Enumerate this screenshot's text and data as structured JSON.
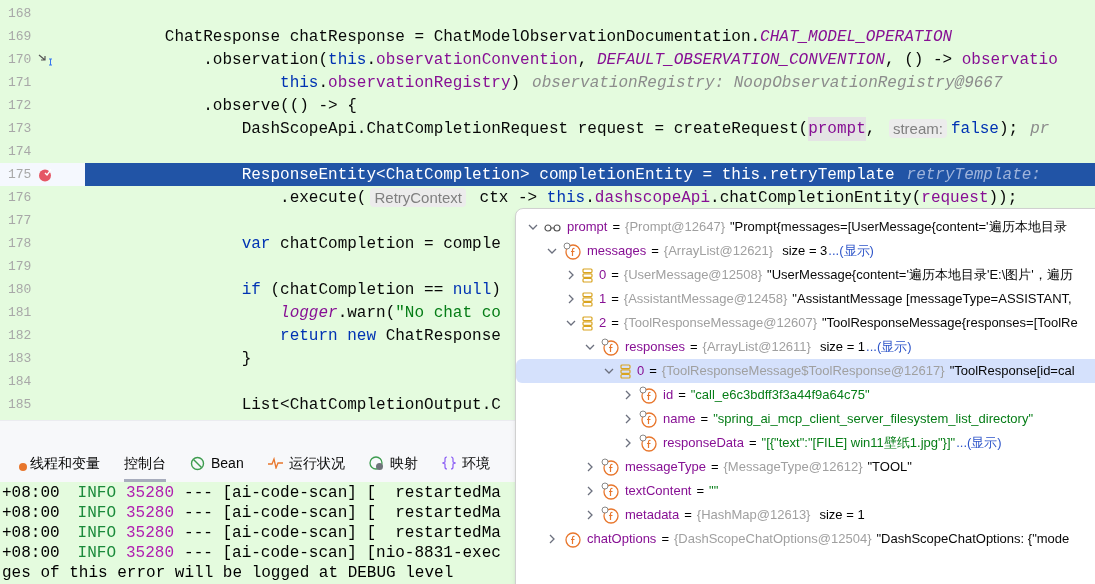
{
  "editor": {
    "lines": [
      {
        "number": "168",
        "kind": "code",
        "selected": false
      },
      {
        "number": "169",
        "kind": "code",
        "selected": false,
        "tokens": [
          {
            "kind": "plain",
            "text": "        ChatResponse chatResponse = ChatModelObservationDocumentation."
          },
          {
            "kind": "const",
            "text": "CHAT_MODEL_OPERATION"
          }
        ]
      },
      {
        "number": "170",
        "kind": "step",
        "selected": false,
        "tokens": [
          {
            "kind": "plain",
            "text": "            .observation("
          },
          {
            "kind": "kw",
            "text": "this"
          },
          {
            "kind": "plain",
            "text": "."
          },
          {
            "kind": "field",
            "text": "observationConvention"
          },
          {
            "kind": "plain",
            "text": ", "
          },
          {
            "kind": "const",
            "text": "DEFAULT_OBSERVATION_CONVENTION"
          },
          {
            "kind": "plain",
            "text": ", () -> "
          },
          {
            "kind": "field",
            "text": "observatio"
          }
        ]
      },
      {
        "number": "171",
        "kind": "code",
        "selected": false,
        "tokens": [
          {
            "kind": "kw",
            "text": "                    this"
          },
          {
            "kind": "plain",
            "text": "."
          },
          {
            "kind": "field",
            "text": "observationRegistry"
          },
          {
            "kind": "plain",
            "text": ")"
          },
          {
            "kind": "hint",
            "text": "observationRegistry: NoopObservationRegistry@9667"
          }
        ]
      },
      {
        "number": "172",
        "kind": "code",
        "selected": false,
        "tokens": [
          {
            "kind": "plain",
            "text": "            .observe(() -> {"
          }
        ]
      },
      {
        "number": "173",
        "kind": "code",
        "selected": false,
        "tokens": [
          {
            "kind": "plain",
            "text": "                DashScopeApi.ChatCompletionRequest request = createRequest("
          },
          {
            "kind": "usage",
            "text": "prompt"
          },
          {
            "kind": "plain",
            "text": ", "
          },
          {
            "kind": "inlay",
            "text": "stream:"
          },
          {
            "kind": "kw",
            "text": "false"
          },
          {
            "kind": "plain",
            "text": ");"
          },
          {
            "kind": "hint",
            "text": "pr"
          }
        ]
      },
      {
        "number": "174",
        "kind": "code",
        "selected": false
      },
      {
        "number": "175",
        "kind": "breakpoint",
        "selected": true,
        "tokens": [
          {
            "kind": "plain",
            "text": "                ResponseEntity<ChatCompletion> completionEntity = this.retryTemplate"
          },
          {
            "kind": "hint",
            "text": "retryTemplate:"
          }
        ]
      },
      {
        "number": "176",
        "kind": "code",
        "selected": false,
        "tokens": [
          {
            "kind": "plain",
            "text": "                    .execute("
          },
          {
            "kind": "inlay",
            "text": "RetryContext"
          },
          {
            "kind": "plain",
            "text": " ctx -> "
          },
          {
            "kind": "kw",
            "text": "this"
          },
          {
            "kind": "plain",
            "text": "."
          },
          {
            "kind": "field",
            "text": "dashscopeApi"
          },
          {
            "kind": "plain",
            "text": ".chatCompletionEntity("
          },
          {
            "kind": "field",
            "text": "request"
          },
          {
            "kind": "plain",
            "text": "));"
          }
        ]
      },
      {
        "number": "177",
        "kind": "code",
        "selected": false
      },
      {
        "number": "178",
        "kind": "code",
        "selected": false,
        "tokens": [
          {
            "kind": "kw",
            "text": "                var"
          },
          {
            "kind": "plain",
            "text": " chatCompletion = comple"
          }
        ]
      },
      {
        "number": "179",
        "kind": "code",
        "selected": false
      },
      {
        "number": "180",
        "kind": "code",
        "selected": false,
        "tokens": [
          {
            "kind": "kw",
            "text": "                if"
          },
          {
            "kind": "plain",
            "text": " (chatCompletion == "
          },
          {
            "kind": "kw",
            "text": "null"
          },
          {
            "kind": "plain",
            "text": ")"
          }
        ]
      },
      {
        "number": "181",
        "kind": "code",
        "selected": false,
        "tokens": [
          {
            "kind": "const",
            "text": "                    logger"
          },
          {
            "kind": "plain",
            "text": ".warn("
          },
          {
            "kind": "str",
            "text": "\"No chat co"
          }
        ]
      },
      {
        "number": "182",
        "kind": "code",
        "selected": false,
        "tokens": [
          {
            "kind": "kw",
            "text": "                    return new"
          },
          {
            "kind": "plain",
            "text": " ChatResponse"
          }
        ]
      },
      {
        "number": "183",
        "kind": "code",
        "selected": false,
        "tokens": [
          {
            "kind": "plain",
            "text": "                }"
          }
        ]
      },
      {
        "number": "184",
        "kind": "code",
        "selected": false
      },
      {
        "number": "185",
        "kind": "code",
        "selected": false,
        "tokens": [
          {
            "kind": "plain",
            "text": "                List<ChatCompletionOutput.C"
          }
        ]
      }
    ]
  },
  "bottom_panel": {
    "tabs": [
      {
        "label": "线程和变量",
        "kind": "threads",
        "selected": false
      },
      {
        "label": "控制台",
        "kind": "plain",
        "selected": true
      },
      {
        "label": "Bean",
        "kind": "bean",
        "selected": false
      },
      {
        "label": "运行状况",
        "kind": "health",
        "selected": false
      },
      {
        "label": "映射",
        "kind": "mappings",
        "selected": false
      },
      {
        "label": "环境",
        "kind": "environment",
        "selected": false
      }
    ],
    "console": [
      {
        "time": "+08:00",
        "level": "INFO",
        "pid": "35280",
        "text": "--- [ai-code-scan] [  restartedMa"
      },
      {
        "time": "+08:00",
        "level": "INFO",
        "pid": "35280",
        "text": "--- [ai-code-scan] [  restartedMa"
      },
      {
        "time": "+08:00",
        "level": "INFO",
        "pid": "35280",
        "text": "--- [ai-code-scan] [  restartedMa"
      },
      {
        "time": "+08:00",
        "level": "INFO",
        "pid": "35280",
        "text": "--- [ai-code-scan] [nio-8831-exec"
      },
      {
        "text": "ges of this error will be logged at DEBUG level"
      }
    ]
  },
  "debug_popup": {
    "tree": [
      {
        "kind": "watch",
        "name": "prompt",
        "op": "=",
        "type": "{Prompt@12647}",
        "value": "\"Prompt{messages=[UserMessage{content='遍历本地目录",
        "expanded": true,
        "selected": false,
        "children": [
          {
            "kind": "field",
            "name": "messages",
            "op": "=",
            "type": "{ArrayList@12621}",
            "size": "size = 3",
            "link": "...(显示)",
            "expanded": true,
            "selected": false,
            "children": [
              {
                "kind": "element",
                "name": "0",
                "op": "=",
                "type": "{UserMessage@12508}",
                "value": "\"UserMessage{content='遍历本地目录'E:\\图片'，遍历",
                "expanded": false,
                "selected": false
              },
              {
                "kind": "element",
                "name": "1",
                "op": "=",
                "type": "{AssistantMessage@12458}",
                "value": "\"AssistantMessage [messageType=ASSISTANT,",
                "expanded": false,
                "selected": false
              },
              {
                "kind": "element",
                "name": "2",
                "op": "=",
                "type": "{ToolResponseMessage@12607}",
                "value": "\"ToolResponseMessage{responses=[ToolRe",
                "expanded": true,
                "selected": false,
                "children": [
                  {
                    "kind": "field",
                    "name": "responses",
                    "op": "=",
                    "type": "{ArrayList@12611}",
                    "size": "size = 1",
                    "link": "...(显示)",
                    "expanded": true,
                    "selected": false,
                    "children": [
                      {
                        "kind": "element",
                        "name": "0",
                        "op": "=",
                        "type": "{ToolResponseMessage$ToolResponse@12617}",
                        "value": "\"ToolResponse[id=cal",
                        "expanded": true,
                        "selected": true,
                        "children": [
                          {
                            "kind": "field",
                            "name": "id",
                            "op": "=",
                            "string_value": "\"call_e6c3bdff3f3a44f9a64c75\"",
                            "expanded": false,
                            "selected": false
                          },
                          {
                            "kind": "field",
                            "name": "name",
                            "op": "=",
                            "string_value": "\"spring_ai_mcp_client_server_filesystem_list_directory\"",
                            "expanded": false,
                            "selected": false
                          },
                          {
                            "kind": "field",
                            "name": "responseData",
                            "op": "=",
                            "string_value": "\"[{\"text\":\"[FILE] win11壁纸1.jpg\"}]\"",
                            "link": "...(显示)",
                            "expanded": false,
                            "selected": false
                          }
                        ]
                      }
                    ]
                  },
                  {
                    "kind": "field",
                    "name": "messageType",
                    "op": "=",
                    "type": "{MessageType@12612}",
                    "value": "\"TOOL\"",
                    "expanded": false,
                    "selected": false
                  },
                  {
                    "kind": "field",
                    "name": "textContent",
                    "op": "=",
                    "string_value": "\"\"",
                    "expanded": false,
                    "selected": false
                  },
                  {
                    "kind": "field",
                    "name": "metadata",
                    "op": "=",
                    "type": "{HashMap@12613}",
                    "size": "size = 1",
                    "expanded": false,
                    "selected": false
                  }
                ]
              }
            ]
          },
          {
            "kind": "plainfield",
            "name": "chatOptions",
            "op": "=",
            "type": "{DashScopeChatOptions@12504}",
            "value": "\"DashScopeChatOptions: {\"mode",
            "expanded": false,
            "selected": false
          }
        ]
      }
    ]
  }
}
